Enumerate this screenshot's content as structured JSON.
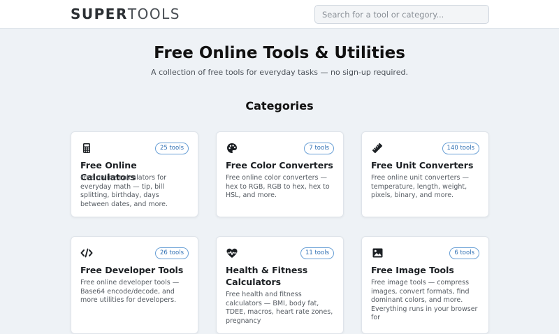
{
  "header": {
    "logo_bold": "SUPER",
    "logo_light": "TOOLS",
    "search_placeholder": "Search for a tool or category..."
  },
  "hero": {
    "title": "Free Online Tools & Utilities",
    "subtitle": "A collection of free tools for everyday tasks — no sign-up required."
  },
  "categories_title": "Categories",
  "categories": [
    {
      "icon": "calculator-icon",
      "badge": "25 tools",
      "title": "Free Online Calculators",
      "desc": "Free online calculators for everyday math — tip, bill splitting, birthday, days between dates, and more."
    },
    {
      "icon": "palette-icon",
      "badge": "7 tools",
      "title": "Free Color Converters",
      "desc": "Free online color converters — hex to RGB, RGB to hex, hex to HSL, and more."
    },
    {
      "icon": "ruler-icon",
      "badge": "140 tools",
      "title": "Free Unit Converters",
      "desc": "Free online unit converters — temperature, length, weight, pixels, binary, and more."
    },
    {
      "icon": "code-icon",
      "badge": "26 tools",
      "title": "Free Developer Tools",
      "desc": "Free online developer tools — Base64 encode/decode, and more utilities for developers."
    },
    {
      "icon": "heartbeat-icon",
      "badge": "11 tools",
      "title": "Health & Fitness Calculators",
      "desc": "Free health and fitness calculators — BMI, body fat, TDEE, macros, heart rate zones, pregnancy"
    },
    {
      "icon": "image-icon",
      "badge": "6 tools",
      "title": "Free Image Tools",
      "desc": "Free image tools — compress images, convert formats, find dominant colors, and more. Everything runs in your browser for"
    }
  ],
  "colors": {
    "accent": "#2f6fb3",
    "background": "#eef2f6"
  }
}
